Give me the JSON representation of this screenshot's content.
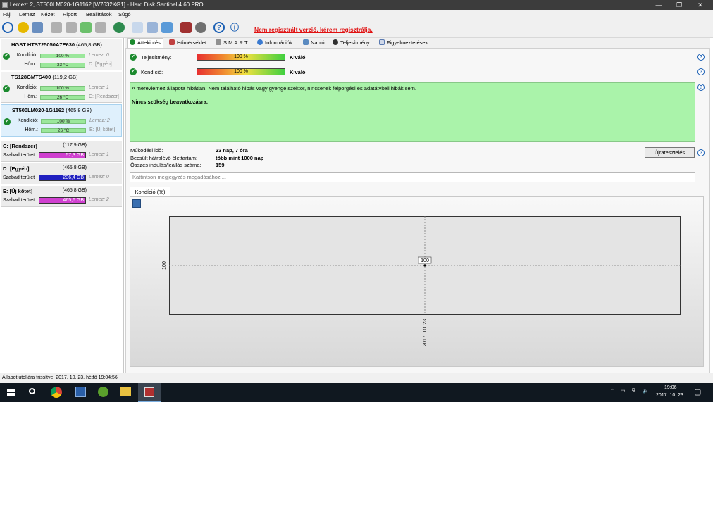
{
  "window": {
    "title": "Lemez: 2, ST500LM020-1G1162 [W7632KG1]  -  Hard Disk Sentinel 4.60 PRO",
    "controls": [
      "—",
      "❐",
      "✕"
    ]
  },
  "menu": [
    "Fájl",
    "Lemez",
    "Nézet",
    "Riport",
    "Beállítások",
    "Súgó"
  ],
  "toolbar": {
    "register_link": "Nem regisztrált verzió, kérem regisztrálja."
  },
  "disks": [
    {
      "name": "HGST HTS725050A7E630",
      "size": "(465,8 GB)",
      "health_label": "Kondíció:",
      "health": "100 %",
      "temp_label": "Hőm.:",
      "temp": "33 °C",
      "info1": "Lemez: 0",
      "info2": "D: [Egyéb]"
    },
    {
      "name": "TS128GMTS400",
      "size": "(119,2 GB)",
      "health_label": "Kondíció:",
      "health": "100 %",
      "temp_label": "Hőm.:",
      "temp": "26 °C",
      "info1": "Lemez: 1",
      "info2": "C: [Rendszer]"
    },
    {
      "name": "ST500LM020-1G1162",
      "size": "(465,8 GB)",
      "health_label": "Kondíció:",
      "health": "100 %",
      "temp_label": "Hőm.:",
      "temp": "26 °C",
      "info1": "Lemez: 2",
      "info2": "E: [Új kötet]"
    }
  ],
  "partitions": [
    {
      "name": "C: [Rendszer]",
      "size": "(117,9 GB)",
      "free_label": "Szabad terület",
      "free": "57,3 GB",
      "disk": "Lemez: 1",
      "color": "#d040d0"
    },
    {
      "name": "D: [Egyéb]",
      "size": "(465,8 GB)",
      "free_label": "Szabad terület",
      "free": "236,4 GB",
      "disk": "Lemez: 0",
      "color": "#2020c0"
    },
    {
      "name": "E: [Új kötet]",
      "size": "(465,8 GB)",
      "free_label": "Szabad terület",
      "free": "465,6 GB",
      "disk": "Lemez: 2",
      "color": "#d040d0"
    }
  ],
  "tabs": [
    "Áttekintés",
    "Hőmérséklet",
    "S.M.A.R.T.",
    "Információk",
    "Napló",
    "Teljesítmény",
    "Figyelmeztetések"
  ],
  "overview": {
    "performance_label": "Teljesítmény:",
    "performance_value": "100 %",
    "performance_verdict": "Kiváló",
    "health_label": "Kondíció:",
    "health_value": "100 %",
    "health_verdict": "Kiváló",
    "status_message": "A merevlemez állapota hibátlan. Nem található hibás vagy gyenge szektor, nincsenek felpörgési és adatátviteli hibák sem.",
    "recommendation": "Nincs szükség beavatkozásra.",
    "power_on_label": "Működési idő:",
    "power_on_value": "23 nap, 7 óra",
    "lifetime_label": "Becsült hátralévő élettartam:",
    "lifetime_value": "több mint 1000 nap",
    "starts_label": "Összes indulás/leállás száma:",
    "starts_value": "159",
    "retest_button": "Újratesztelés",
    "note_placeholder": "Kattintson megjegyzés megadásához ..."
  },
  "chart_tab": "Kondíció  (%)",
  "chart_data": {
    "type": "line",
    "title": "",
    "xlabel": "",
    "ylabel": "",
    "x": [
      "2017. 10. 23."
    ],
    "series": [
      {
        "values": [
          100
        ]
      }
    ],
    "y_tick": "100",
    "point_label": "100"
  },
  "statusbar": "Állapot utoljára frissítve: 2017. 10. 23. hétfő 19:04:56",
  "taskbar": {
    "time": "19:06",
    "date": "2017. 10. 23."
  }
}
